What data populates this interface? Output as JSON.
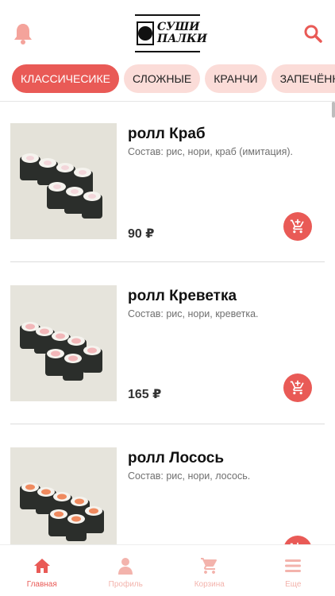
{
  "header": {
    "logo_line1": "СУШИ",
    "logo_line2": "ПАЛКИ",
    "bell_icon": "bell-icon",
    "search_icon": "search-icon"
  },
  "tabs": [
    {
      "label": "КЛАССИЧЕСИКЕ",
      "active": true
    },
    {
      "label": "СЛОЖНЫЕ",
      "active": false
    },
    {
      "label": "КРАНЧИ",
      "active": false
    },
    {
      "label": "ЗАПЕЧЁННЫЕ",
      "active": false
    }
  ],
  "products": [
    {
      "name": "ролл Краб",
      "description": "Состав: рис, нори, краб (имитация).",
      "price": "90 ₽",
      "filling": "crab"
    },
    {
      "name": "ролл Креветка",
      "description": "Состав: рис, нори, креветка.",
      "price": "165 ₽",
      "filling": "shrimp"
    },
    {
      "name": "ролл Лосось",
      "description": "Состав: рис, нори, лосось.",
      "price": "",
      "filling": "salmon"
    }
  ],
  "bottom_nav": [
    {
      "label": "Главная",
      "icon": "home-icon",
      "active": true
    },
    {
      "label": "Профиль",
      "icon": "user-icon",
      "active": false
    },
    {
      "label": "Корзина",
      "icon": "cart-icon",
      "active": false
    },
    {
      "label": "Еще",
      "icon": "menu-icon",
      "active": false
    }
  ],
  "colors": {
    "accent": "#e95a56",
    "tab_inactive": "#fbdcd8",
    "nav_inactive": "#f3b3ac",
    "crab_filling": "#f3d6da",
    "shrimp_filling": "#f2b7b9",
    "salmon_filling": "#ef8a5f"
  }
}
